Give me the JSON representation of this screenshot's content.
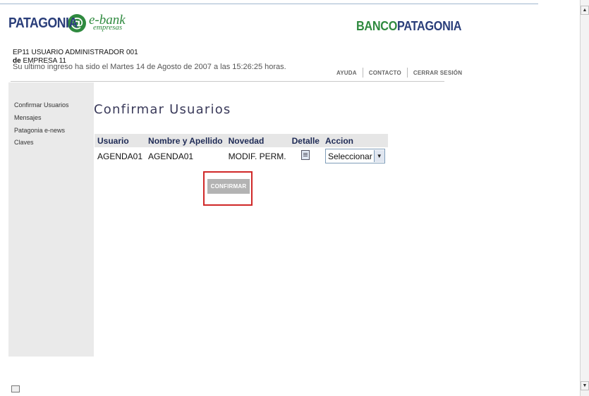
{
  "brand": {
    "logo_text": "PATAGONIA",
    "ebank_main": "e-bank",
    "ebank_sub": "empresas",
    "bank_name_a": "BANCO",
    "bank_name_b": "PATAGONIA",
    "accent_green": "#2f8a3f",
    "accent_blue": "#2a3e7a"
  },
  "session": {
    "user_line": "EP11 USUARIO ADMINISTRADOR 001",
    "de_label": "de",
    "company": "EMPRESA 11",
    "last_login": "Su ultimo ingreso ha sido el Martes 14 de Agosto de 2007 a las 15:26:25 horas."
  },
  "top_links": [
    "AYUDA",
    "CONTACTO",
    "CERRAR SESIÓN"
  ],
  "sidebar": {
    "items": [
      {
        "label": "Confirmar Usuarios"
      },
      {
        "label": "Mensajes"
      },
      {
        "label": "Patagonia e-news"
      },
      {
        "label": "Claves"
      }
    ]
  },
  "main": {
    "title": "Confirmar Usuarios",
    "table": {
      "headers": [
        "Usuario",
        "Nombre y Apellido",
        "Novedad",
        "Detalle",
        "Accion"
      ],
      "rows": [
        {
          "usuario": "AGENDA01",
          "nombre": "AGENDA01",
          "novedad": "MODIF. PERM.",
          "detalle_icon": "document-icon",
          "accion_selected": "Seleccionar"
        }
      ]
    },
    "confirm_label": "CONFIRMAR",
    "highlight_color": "#d02828"
  },
  "scrollbar": {
    "up_icon": "▲",
    "down_icon": "▼"
  }
}
